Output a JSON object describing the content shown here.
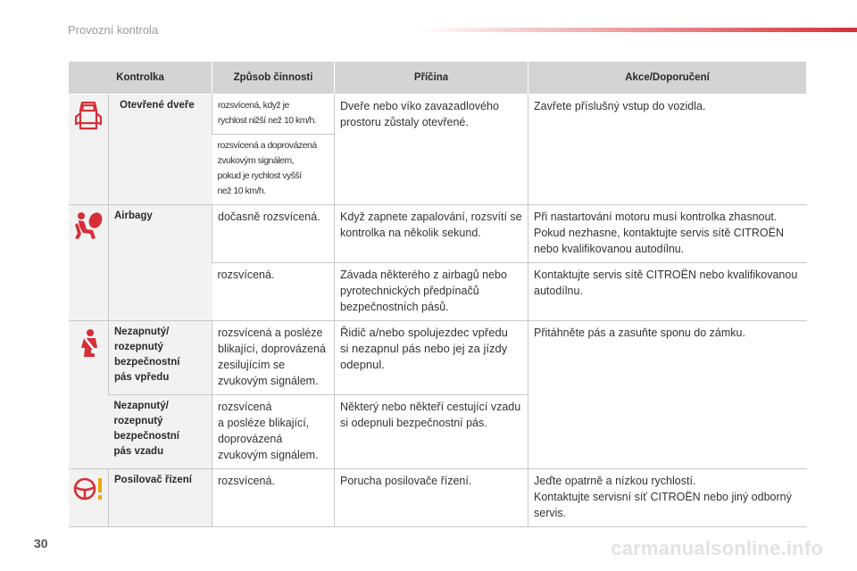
{
  "header": {
    "title": "Provozní kontrola"
  },
  "page_number": "30",
  "watermark": "carmanualsonline.info",
  "colors": {
    "icon_red": "#d62f37",
    "header_gray": "#d4d4d4",
    "cell_gray": "#f2f2f2"
  },
  "table": {
    "headers": [
      "Kontrolka",
      "Způsob činnosti",
      "Příčina",
      "Akce/Doporučení"
    ],
    "doors": {
      "icon": "open-doors-icon",
      "name": "Otevřené dveře",
      "mode1": "rozsvícená, když je\nrychlost nižší než 10 km/h.",
      "mode2": "rozsvícená a doprovázená\nzvukovým signálem,\npokud je rychlost vyšší\nnež 10 km/h.",
      "cause": "Dveře nebo víko zavazadlového\nprostoru zůstaly otevřené.",
      "action": "Zavřete příslušný vstup do vozidla."
    },
    "airbags": {
      "icon": "airbag-icon",
      "name": "Airbagy",
      "mode1": "dočasně rozsvícená.",
      "cause1": "Když zapnete zapalování, rozsvítí se\nkontrolka na několik sekund.",
      "action1": "Při nastartování motoru musí kontrolka zhasnout.\nPokud nezhasne, kontaktujte servis sítě CITROËN\nnebo kvalifikovanou autodílnu.",
      "mode2": "rozsvícená.",
      "cause2": "Závada některého z airbagů nebo\npyrotechnických předpínačů\nbezpečnostních pásů.",
      "action2": "Kontaktujte servis sítě CITROËN nebo kvalifikovanou\nautodílnu."
    },
    "seatbelt": {
      "icon": "seatbelt-icon",
      "name_front": "Nezapnutý/\nrozepnutý\nbezpečnostní\npás vpředu",
      "mode_front": "rozsvícená a posléze\nblikající, doprovázená\nzesilujícím se\nzvukovým signálem.",
      "cause_front": "Řidič a/nebo spolujezdec vpředu\nsi nezapnul pás nebo jej za jízdy\nodepnul.",
      "action": "Přitáhněte pás a zasuňte sponu do zámku.",
      "name_rear": "Nezapnutý/\nrozepnutý\nbezpečnostní\npás vzadu",
      "mode_rear": "rozsvícená\na posléze blikající,\ndoprovázená\nzvukovým signálem.",
      "cause_rear": "Některý nebo někteří cestující vzadu\nsi odepnuli bezpečnostní pás."
    },
    "steering": {
      "icon": "power-steering-icon",
      "name": "Posilovač řízení",
      "mode": "rozsvícená.",
      "cause": "Porucha posilovače řízení.",
      "action": "Jeďte opatrně a nízkou rychlostí.\nKontaktujte servisní síť CITROËN nebo jiný odborný\nservis."
    }
  }
}
